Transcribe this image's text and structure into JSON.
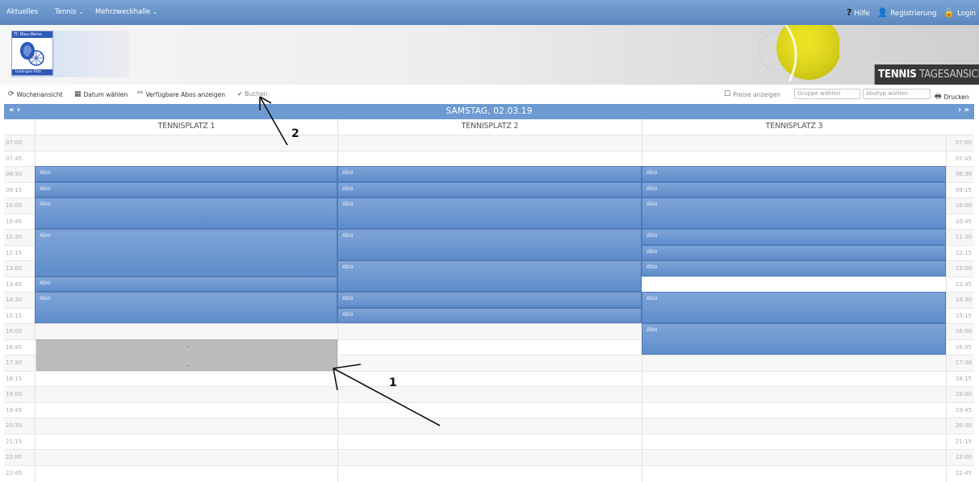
{
  "topnav": {
    "items": [
      {
        "label": "Aktuelles",
        "has_caret": false
      },
      {
        "label": "Tennis",
        "has_caret": true
      },
      {
        "label": "Mehrzweckhalle",
        "has_caret": true
      }
    ],
    "help": "Hilfe",
    "register": "Registrierung",
    "login": "Login"
  },
  "logo": {
    "top_text": "TC Blau-Weiss",
    "bottom_text": "Uahingen Plzh"
  },
  "header": {
    "title_bold": "TENNIS",
    "title_light": "TAGESANSICHT"
  },
  "toolbar": {
    "week_view": "Wochenansicht",
    "pick_date": "Datum wählen",
    "available_abos": "Verfügbare Abos anzeigen",
    "book": "Buchen",
    "show_prices": "Preise anzeigen",
    "group_select": "Gruppe wählen",
    "abotype_select": "Abotyp wählen",
    "print": "Drucken"
  },
  "calendar": {
    "date": "SAMSTAG, 02.03.19",
    "prev_label": "« ‹",
    "next_label": "› »",
    "courts": [
      "TENNISPLATZ 1",
      "TENNISPLATZ 2",
      "TENNISPLATZ 3"
    ],
    "times": [
      "07:00",
      "07:45",
      "08:30",
      "09:15",
      "10:00",
      "10:45",
      "11:30",
      "12:15",
      "13:00",
      "13:45",
      "14:30",
      "15:15",
      "16:00",
      "16:45",
      "17:30",
      "18:15",
      "19:00",
      "19:45",
      "20:30",
      "21:15",
      "22:00",
      "22:45"
    ],
    "booking_label": "Abo",
    "bookings": [
      {
        "court": 0,
        "start": 2,
        "span": 1
      },
      {
        "court": 0,
        "start": 3,
        "span": 1
      },
      {
        "court": 0,
        "start": 4,
        "span": 2
      },
      {
        "court": 0,
        "start": 6,
        "span": 3
      },
      {
        "court": 0,
        "start": 9,
        "span": 1
      },
      {
        "court": 0,
        "start": 10,
        "span": 2
      },
      {
        "court": 1,
        "start": 2,
        "span": 1
      },
      {
        "court": 1,
        "start": 3,
        "span": 1
      },
      {
        "court": 1,
        "start": 4,
        "span": 2
      },
      {
        "court": 1,
        "start": 6,
        "span": 2
      },
      {
        "court": 1,
        "start": 8,
        "span": 2
      },
      {
        "court": 1,
        "start": 10,
        "span": 1
      },
      {
        "court": 1,
        "start": 11,
        "span": 1
      },
      {
        "court": 2,
        "start": 2,
        "span": 1
      },
      {
        "court": 2,
        "start": 3,
        "span": 1
      },
      {
        "court": 2,
        "start": 4,
        "span": 2
      },
      {
        "court": 2,
        "start": 6,
        "span": 1
      },
      {
        "court": 2,
        "start": 7,
        "span": 1
      },
      {
        "court": 2,
        "start": 8,
        "span": 1
      },
      {
        "court": 2,
        "start": 10,
        "span": 2
      },
      {
        "court": 2,
        "start": 12,
        "span": 2
      }
    ],
    "selected": {
      "court": 0,
      "start": 13,
      "span": 2
    }
  },
  "annotations": [
    "1",
    "2"
  ],
  "colors": {
    "nav": "#6a96cb",
    "header_bar": "#6d9bd1",
    "booking": "#6f98d1",
    "selected": "#bcbcbc",
    "badge": "#383838"
  }
}
